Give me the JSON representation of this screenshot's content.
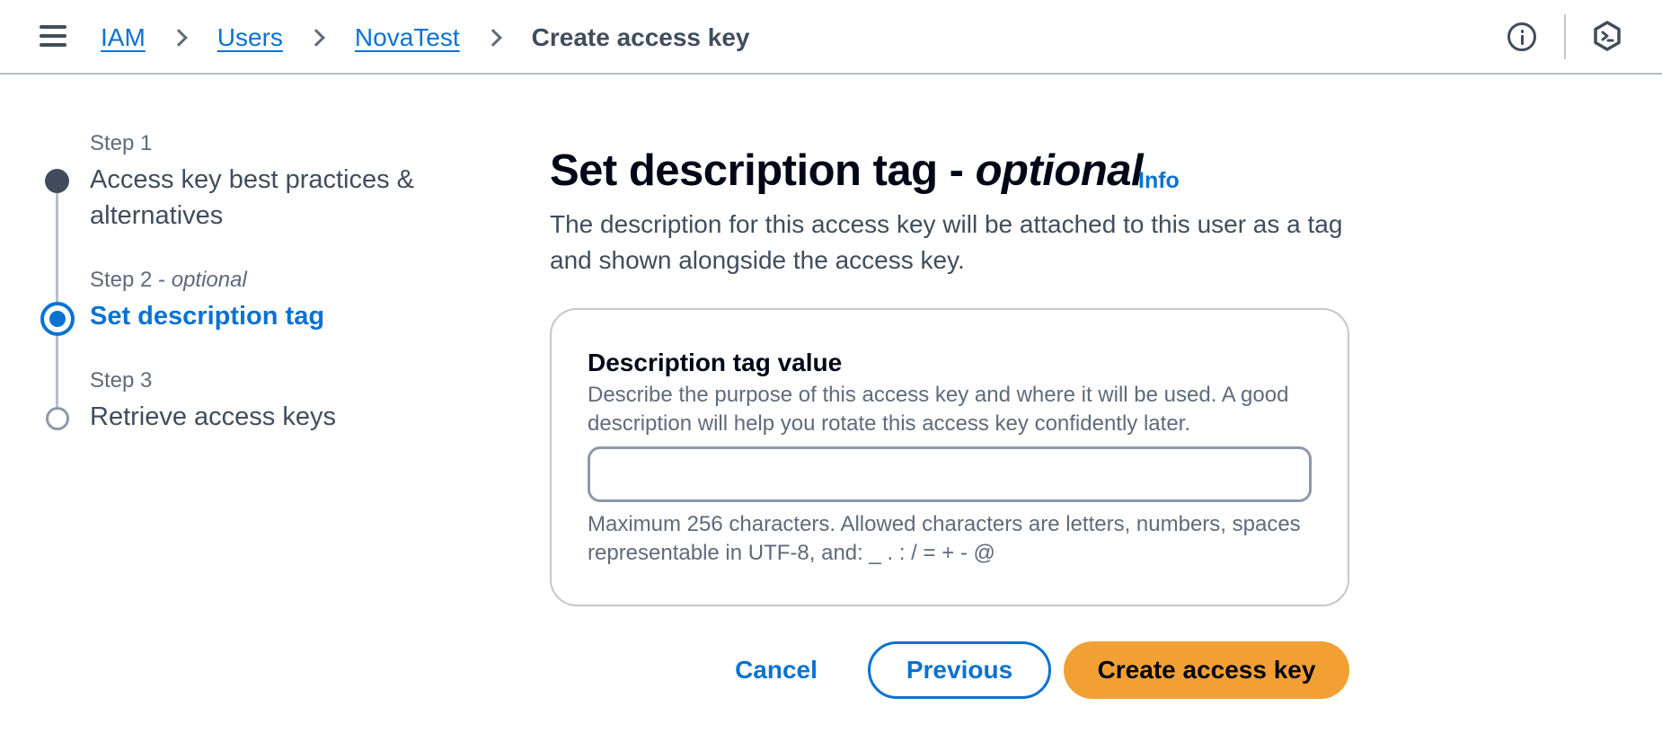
{
  "header": {
    "breadcrumbs": [
      {
        "label": "IAM",
        "link": true
      },
      {
        "label": "Users",
        "link": true
      },
      {
        "label": "NovaTest",
        "link": true
      },
      {
        "label": "Create access key",
        "link": false
      }
    ],
    "icons": [
      "hamburger-menu-icon",
      "info-circle-icon",
      "cloudshell-hexagon-icon"
    ]
  },
  "stepper": {
    "steps": [
      {
        "caption": "Step 1",
        "caption_suffix": "",
        "title": "Access key best practices & alternatives",
        "state": "completed"
      },
      {
        "caption": "Step 2 - ",
        "caption_suffix": "optional",
        "title": "Set description tag",
        "state": "active"
      },
      {
        "caption": "Step 3",
        "caption_suffix": "",
        "title": "Retrieve access keys",
        "state": "upcoming"
      }
    ]
  },
  "main": {
    "title_prefix": "Set description tag - ",
    "title_optional": "optional",
    "info_link": "Info",
    "description": "The description for this access key will be attached to this user as a tag and shown alongside the access key.",
    "field": {
      "label": "Description tag value",
      "description": "Describe the purpose of this access key and where it will be used. A good description will help you rotate this access key confidently later.",
      "value": "",
      "hint": "Maximum 256 characters. Allowed characters are letters, numbers, spaces representable in UTF-8, and: _ . : / = + - @"
    }
  },
  "actions": {
    "cancel": "Cancel",
    "previous": "Previous",
    "create": "Create access key"
  },
  "colors": {
    "link": "#0972d3",
    "primary_button": "#f2a033",
    "text": "#000716",
    "muted": "#5f6b7a"
  }
}
